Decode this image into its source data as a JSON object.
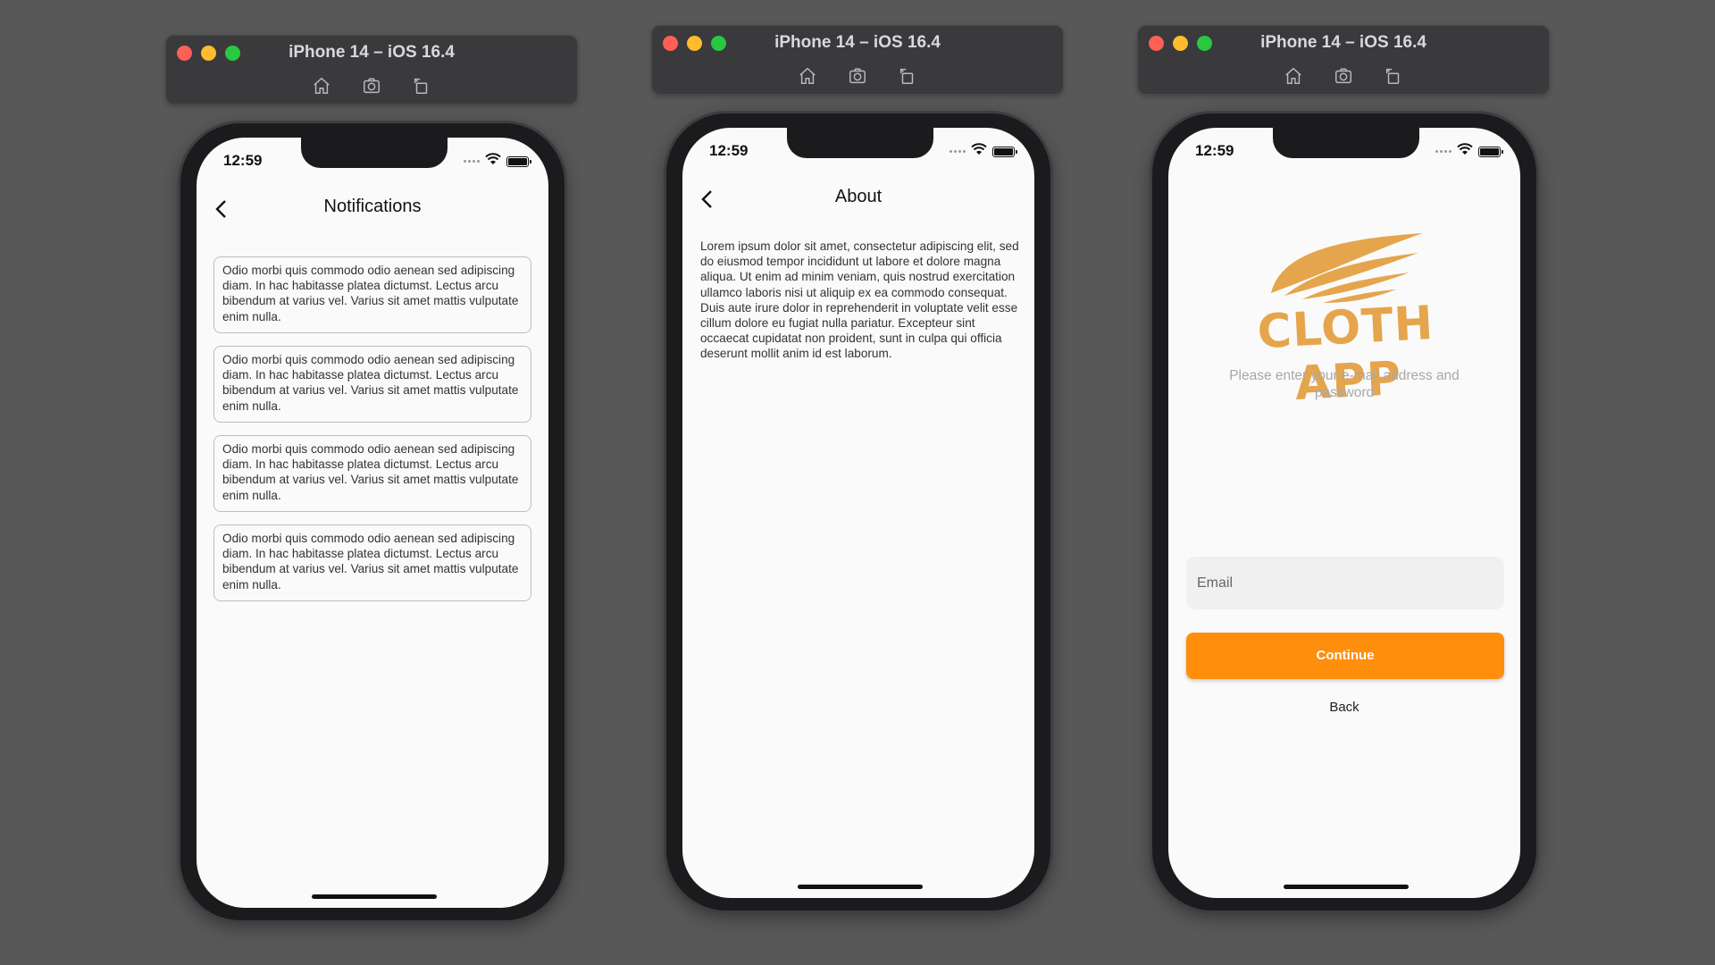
{
  "simulators": [
    {
      "window_title": "iPhone 14 – iOS 16.4",
      "status_time": "12:59",
      "nav_title": "Notifications",
      "notifications": [
        "Odio morbi quis commodo odio aenean sed adipiscing diam. In hac habitasse platea dictumst. Lectus arcu bibendum at varius vel. Varius sit amet mattis vulputate enim nulla.",
        "Odio morbi quis commodo odio aenean sed adipiscing diam. In hac habitasse platea dictumst. Lectus arcu bibendum at varius vel. Varius sit amet mattis vulputate enim nulla.",
        "Odio morbi quis commodo odio aenean sed adipiscing diam. In hac habitasse platea dictumst. Lectus arcu bibendum at varius vel. Varius sit amet mattis vulputate enim nulla.",
        "Odio morbi quis commodo odio aenean sed adipiscing diam. In hac habitasse platea dictumst. Lectus arcu bibendum at varius vel. Varius sit amet mattis vulputate enim nulla."
      ]
    },
    {
      "window_title": "iPhone 14 – iOS 16.4",
      "status_time": "12:59",
      "nav_title": "About",
      "about_text": "Lorem ipsum dolor sit amet, consectetur adipiscing elit, sed do eiusmod tempor incididunt ut labore et dolore magna aliqua. Ut enim ad minim veniam, quis nostrud exercitation ullamco laboris nisi ut aliquip ex ea commodo consequat. Duis aute irure dolor in reprehenderit in voluptate velit esse cillum dolore eu fugiat nulla pariatur. Excepteur sint occaecat cupidatat non proident, sunt in culpa qui officia deserunt mollit anim id est laborum."
    },
    {
      "window_title": "iPhone 14 – iOS 16.4",
      "status_time": "12:59",
      "logo_text": "CLOTH APP",
      "subtitle": "Please enter your e-mail address and password",
      "email_placeholder": "Email",
      "continue_label": "Continue",
      "back_label": "Back"
    }
  ],
  "toolbar_icons": [
    "home-icon",
    "screenshot-icon",
    "rotate-icon"
  ],
  "colors": {
    "accent": "#ff8e0c",
    "logo": "#e5a54c",
    "background": "#585858"
  }
}
